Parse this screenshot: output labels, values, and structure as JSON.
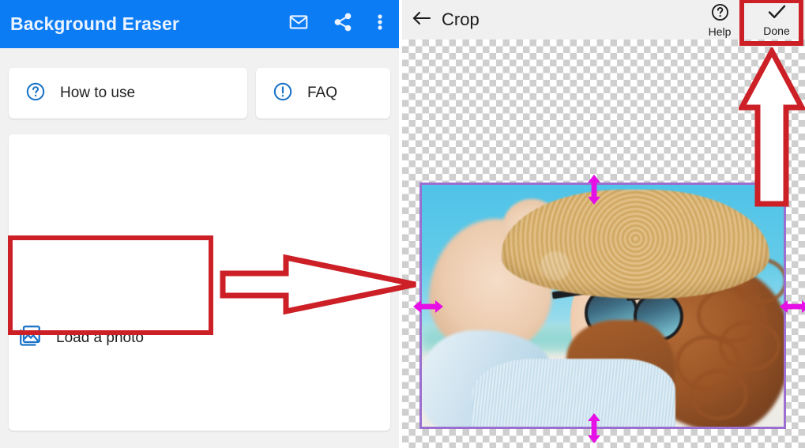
{
  "left_panel": {
    "app_bar": {
      "title": "Background Eraser",
      "background_color": "#0c7cf5",
      "title_color": "#eaf3ff",
      "icons": [
        {
          "name": "mail-icon",
          "glyph": "envelope"
        },
        {
          "name": "share-icon",
          "glyph": "share-nodes"
        },
        {
          "name": "overflow-menu-icon",
          "glyph": "three-vertical-dots"
        }
      ]
    },
    "quick_cards": [
      {
        "name": "how-to-use",
        "label": "How to use",
        "icon": "help-circle-icon",
        "icon_color": "#1a73c8"
      },
      {
        "name": "faq",
        "label": "FAQ",
        "icon": "info-exclamation-circle-icon",
        "icon_color": "#1a73c8"
      }
    ],
    "load_card": {
      "label": "Load a photo",
      "icon": "photo-library-icon",
      "icon_color": "#1a73c8"
    }
  },
  "right_panel": {
    "toolbar": {
      "back_label": "Crop",
      "back_icon": "back-arrow-icon",
      "background_color": "#f0f0f0",
      "actions": [
        {
          "name": "help",
          "label": "Help",
          "icon": "help-circle-icon"
        },
        {
          "name": "done",
          "label": "Done",
          "icon": "checkmark-icon"
        }
      ]
    },
    "canvas": {
      "background": "transparency-checkerboard",
      "checker_colors": [
        "#ffffff",
        "#cfcfcf"
      ]
    },
    "crop_selection": {
      "border_color": "#9b6fd0",
      "handle_color": "#e60fe6",
      "handles": [
        {
          "name": "crop-handle-top",
          "direction": "vertical"
        },
        {
          "name": "crop-handle-bottom",
          "direction": "vertical"
        },
        {
          "name": "crop-handle-left",
          "direction": "horizontal"
        },
        {
          "name": "crop-handle-right",
          "direction": "horizontal"
        }
      ],
      "photo_description": "woman in straw hat and sunglasses at the beach"
    }
  },
  "annotations": {
    "color": "#cc1f26",
    "shapes": [
      {
        "name": "annotation-box-load-a-photo",
        "type": "rectangle"
      },
      {
        "name": "annotation-box-done",
        "type": "rectangle"
      },
      {
        "name": "annotation-arrow-right",
        "type": "arrow",
        "direction": "right"
      },
      {
        "name": "annotation-arrow-up",
        "type": "arrow",
        "direction": "up"
      }
    ]
  }
}
